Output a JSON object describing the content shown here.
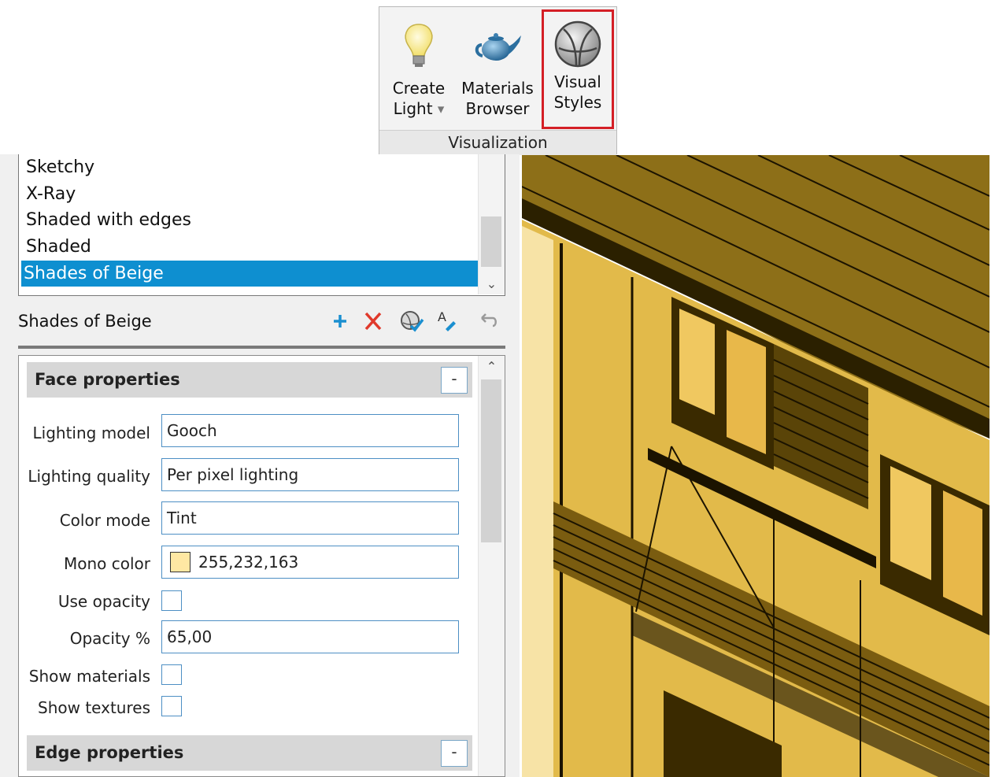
{
  "ribbon": {
    "buttons": [
      {
        "line1": "Create",
        "line2": "Light",
        "icon": "lightbulb-icon"
      },
      {
        "line1": "Materials",
        "line2": "Browser",
        "icon": "teapot-icon"
      },
      {
        "line1": "Visual",
        "line2": "Styles",
        "icon": "visual-styles-sphere-icon"
      }
    ],
    "panel_label": "Visualization",
    "highlight_color": "#d41f26"
  },
  "style_list": {
    "items": [
      "Sketchy",
      "X-Ray",
      "Shaded with edges",
      "Shaded",
      "Shades of Beige"
    ],
    "selected": "Shades of Beige"
  },
  "current_style": "Shades of Beige",
  "toolbar": {
    "icons": [
      "add-icon",
      "delete-icon",
      "apply-to-viewport-icon",
      "rename-icon",
      "undo-icon"
    ]
  },
  "face_properties": {
    "title": "Face properties",
    "collapse_label": "-",
    "lighting_model_label": "Lighting model",
    "lighting_model_value": "Gooch",
    "lighting_quality_label": "Lighting quality",
    "lighting_quality_value": "Per pixel lighting",
    "color_mode_label": "Color mode",
    "color_mode_value": "Tint",
    "mono_color_label": "Mono color",
    "mono_color_value": "255,232,163",
    "mono_color_hex": "#ffe8a3",
    "use_opacity_label": "Use opacity",
    "use_opacity_checked": false,
    "opacity_label": "Opacity %",
    "opacity_value": "65,00",
    "show_materials_label": "Show materials",
    "show_materials_checked": false,
    "show_textures_label": "Show textures",
    "show_textures_checked": false
  },
  "edge_properties": {
    "title": "Edge properties",
    "collapse_label": "-"
  },
  "colors": {
    "selection": "#0e8fd0",
    "field_border": "#4d8fc4",
    "model_face": "#e6bf4f",
    "model_edge": "#1b1300"
  }
}
